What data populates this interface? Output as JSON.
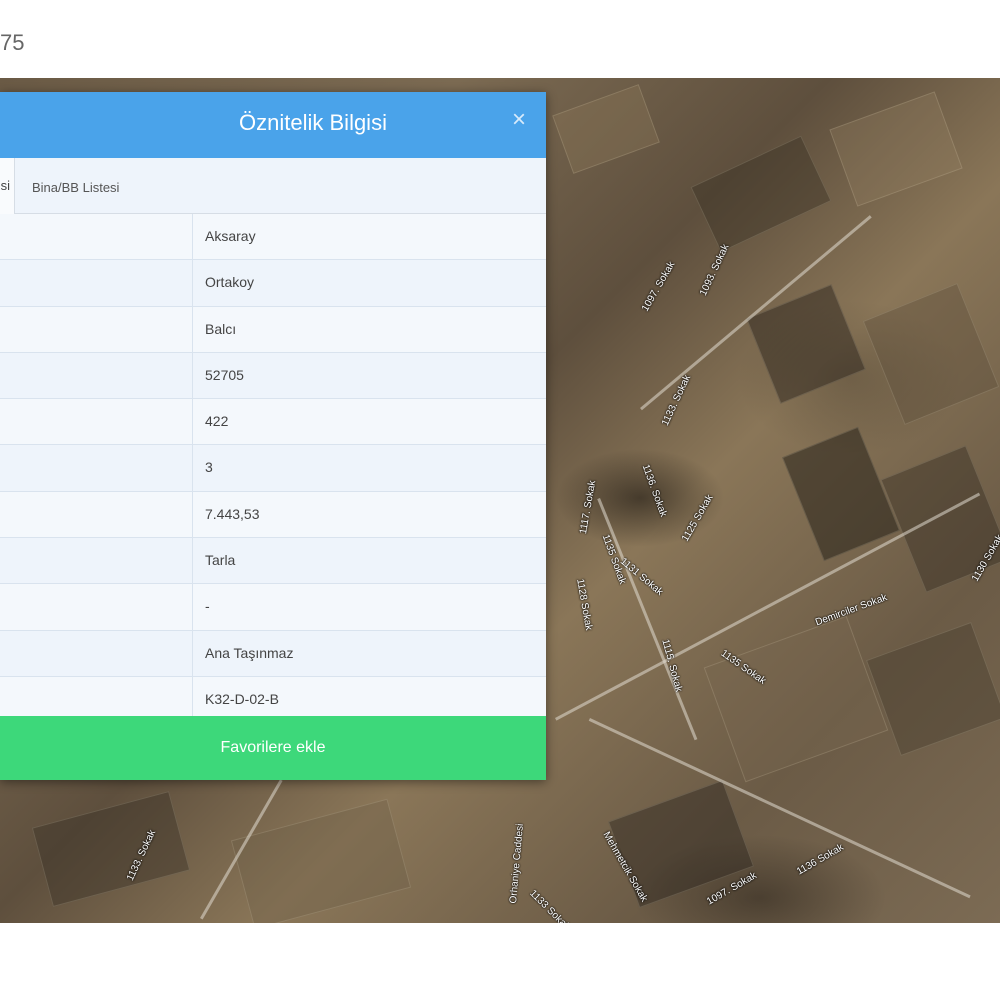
{
  "page": {
    "top_text": "75"
  },
  "dialog": {
    "title": "Öznitelik Bilgisi",
    "close_symbol": "×",
    "tabs": [
      {
        "label": "si",
        "active": true
      },
      {
        "label": "Bina/BB Listesi",
        "active": false
      }
    ],
    "rows": [
      {
        "value": "Aksaray"
      },
      {
        "value": "Ortakoy"
      },
      {
        "value": "Balcı"
      },
      {
        "value": "52705"
      },
      {
        "value": "422"
      },
      {
        "value": "3"
      },
      {
        "value": "7.443,53"
      },
      {
        "value": "Tarla"
      },
      {
        "value": "-"
      },
      {
        "value": "Ana Taşınmaz"
      },
      {
        "value": "K32-D-02-B"
      }
    ],
    "favorite_button": "Favorilere ekle"
  },
  "map": {
    "streets": [
      "1097. Sokak",
      "1093. Sokak",
      "1133. Sokak",
      "1136. Sokak",
      "1125 Sokak",
      "1135 Sokak",
      "Demirciler Sokak",
      "1130 Sokak",
      "1117. Sokak",
      "1128 Sokak",
      "1131 Sokak",
      "1135 Sokak",
      "1115. Sokak",
      "1136 Sokak",
      "1097. Sokak",
      "Mehmetcik Sokak",
      "Orhaniye Caddesi",
      "1133. Sokak",
      "1133 Sokak"
    ],
    "colors": {
      "header": "#4aa3ea",
      "button": "#3dd87a"
    }
  }
}
